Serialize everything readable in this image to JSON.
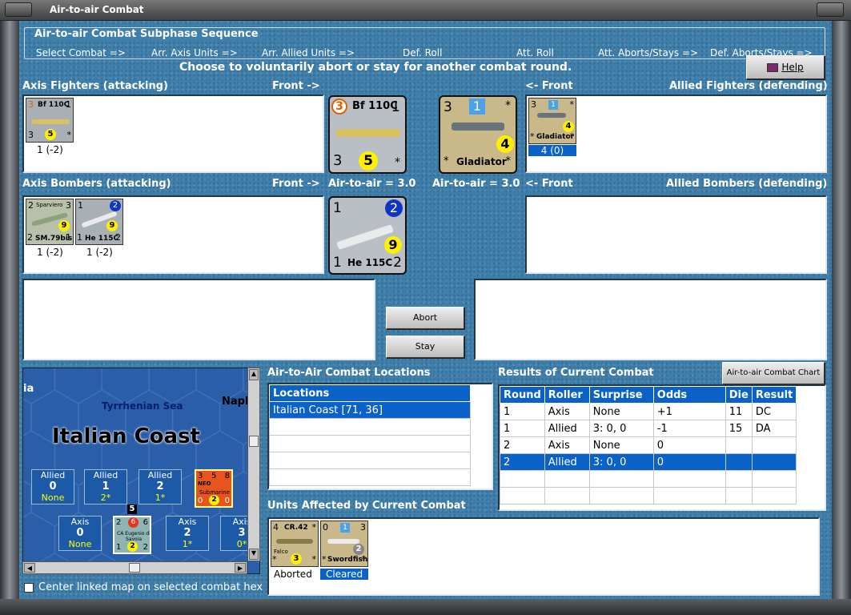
{
  "window": {
    "title": "Air-to-air Combat"
  },
  "sequence": {
    "title": "Air-to-air Combat Subphase Sequence",
    "steps": [
      "Select Combat =>",
      "Arr. Axis Units =>",
      "Arr. Allied Units =>",
      "Def. Roll",
      "Att. Roll",
      "Att. Aborts/Stays =>",
      "Def. Aborts/Stays =>"
    ]
  },
  "prompt": "Choose to voluntarily abort or stay for another combat round.",
  "help_label": "Help",
  "labels": {
    "axis_fighters": "Axis Fighters (attacking)",
    "front_right": "Front ->",
    "front_left": "<- Front",
    "allied_fighters": "Allied Fighters (defending)",
    "axis_bombers": "Axis Bombers (attacking)",
    "allied_bombers": "Allied Bombers (defending)",
    "axis_a2a": "Air-to-air = 3.0",
    "allied_a2a": "Air-to-air = 3.0"
  },
  "axis_fighters": [
    {
      "name": "Bf 110C",
      "tl": "3",
      "tr": "1",
      "bl": "3",
      "br": "*",
      "circle": "5",
      "status": "1 (-2)"
    }
  ],
  "allied_fighters": [
    {
      "name": "Gladiator",
      "tl": "3",
      "tr": "*",
      "box": "1",
      "bl": "*",
      "br": "*",
      "circle": "4",
      "status": "4 (0)"
    }
  ],
  "axis_bombers": [
    {
      "name": "SM.79bis",
      "tl": "2",
      "tr": "3",
      "top": "Sparviero",
      "bl": "2",
      "br": "1",
      "circle": "9",
      "status": "1 (-2)"
    },
    {
      "name": "He 115C",
      "tl": "1",
      "box": "2",
      "bl": "1",
      "br": "2",
      "circle": "9",
      "status": "1 (-2)"
    }
  ],
  "big_axis_fighter": {
    "name": "Bf 110C",
    "tl": "3",
    "tr": "1",
    "bl": "3",
    "br": "*",
    "circle": "5"
  },
  "big_allied_fighter": {
    "name": "Gladiator",
    "tl": "3",
    "tr": "*",
    "box": "1",
    "bl": "*",
    "br": "*",
    "circle": "4"
  },
  "big_axis_bomber": {
    "name": "He 115C",
    "tl": "1",
    "box": "2",
    "bl": "1",
    "br": "2",
    "circle": "9"
  },
  "buttons": {
    "abort": "Abort",
    "stay": "Stay",
    "chart": "Air-to-air Combat Chart"
  },
  "map": {
    "sea": "Tyrrhenian Sea",
    "region": "Italian Coast",
    "left_text": "ia",
    "right_text": "Napl",
    "allied": [
      {
        "label": "Allied",
        "num": "0",
        "val": "None"
      },
      {
        "label": "Allied",
        "num": "1",
        "val": "2*"
      },
      {
        "label": "Allied",
        "num": "2",
        "val": "1*"
      }
    ],
    "axis": [
      {
        "label": "Axis",
        "num": "0",
        "val": "None"
      },
      {
        "label": "Axis",
        "num": "2",
        "val": "1*"
      },
      {
        "label": "Axis",
        "num": "3",
        "val": "0*"
      }
    ],
    "sub": {
      "tl": "3",
      "tm": "5",
      "tr": "8",
      "name": "Submarine",
      "top": "NEO",
      "bl": "0",
      "circle": "2",
      "br": "0"
    },
    "ship": {
      "tl": "2",
      "tm": "6",
      "tr": "6",
      "name": "CA Eugenio di Savoia",
      "bl": "1",
      "circle": "2",
      "br": "2",
      "stack": "5"
    }
  },
  "center_checkbox": "Center linked map on selected combat hex",
  "locations": {
    "title": "Air-to-Air Combat Locations",
    "header": "Locations",
    "rows": [
      "Italian Coast [71, 36]"
    ]
  },
  "results": {
    "title": "Results of Current Combat",
    "headers": [
      "Round",
      "Roller",
      "Surprise",
      "Odds",
      "Die",
      "Result"
    ],
    "rows": [
      [
        "1",
        "Axis",
        "None",
        "+1",
        "11",
        "DC"
      ],
      [
        "1",
        "Allied",
        "3: 0, 0",
        "-1",
        "15",
        "DA"
      ],
      [
        "2",
        "Axis",
        "None",
        "0",
        "",
        ""
      ],
      [
        "2",
        "Allied",
        "3: 0, 0",
        "0",
        "",
        ""
      ]
    ]
  },
  "affected": {
    "title": "Units Affected by Current Combat",
    "units": [
      {
        "name": "CR.42",
        "sub": "Falco",
        "tl": "4",
        "tr": "*",
        "bl": "*",
        "br": "*",
        "circle": "3",
        "status": "Aborted"
      },
      {
        "name": "Swordfish",
        "tl": "0",
        "box": "1",
        "tr": "3",
        "bl": "*",
        "br": "*",
        "circle": "2",
        "status": "Cleared"
      }
    ]
  }
}
